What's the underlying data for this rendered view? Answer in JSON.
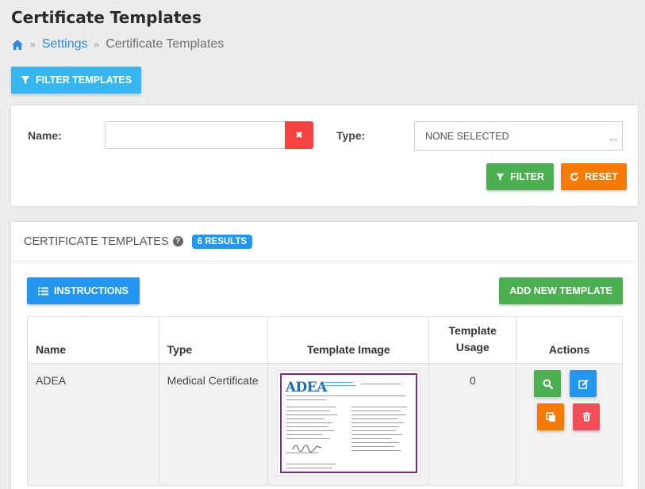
{
  "page": {
    "title": "Certificate Templates"
  },
  "breadcrumb": {
    "home_icon": "home-icon",
    "sep": "»",
    "settings": "Settings",
    "current": "Certificate Templates"
  },
  "filter_toggle": {
    "label": "FILTER TEMPLATES",
    "icon": "filter-icon"
  },
  "filters": {
    "name_label": "Name:",
    "name_value": "",
    "clear_icon": "✖",
    "type_label": "Type:",
    "type_value": "NONE SELECTED",
    "type_dots": "...",
    "filter_label": "FILTER",
    "reset_label": "RESET"
  },
  "results": {
    "title": "CERTIFICATE TEMPLATES",
    "help_icon": "?",
    "count_badge": "6 RESULTS",
    "instructions_label": "INSTRUCTIONS",
    "add_label": "ADD NEW TEMPLATE",
    "columns": [
      "Name",
      "Type",
      "Template Image",
      "Template Usage",
      "Actions"
    ],
    "rows": [
      {
        "name": "ADEA",
        "type": "Medical Certificate",
        "usage": "0",
        "thumbnail_logo": "ADEA"
      }
    ]
  },
  "colors": {
    "accent_blue": "#2196f3",
    "info": "#35b8f0",
    "green": "#4caf50",
    "orange": "#f57c00",
    "red": "#f44336",
    "thumb_border": "#7b2a86"
  }
}
